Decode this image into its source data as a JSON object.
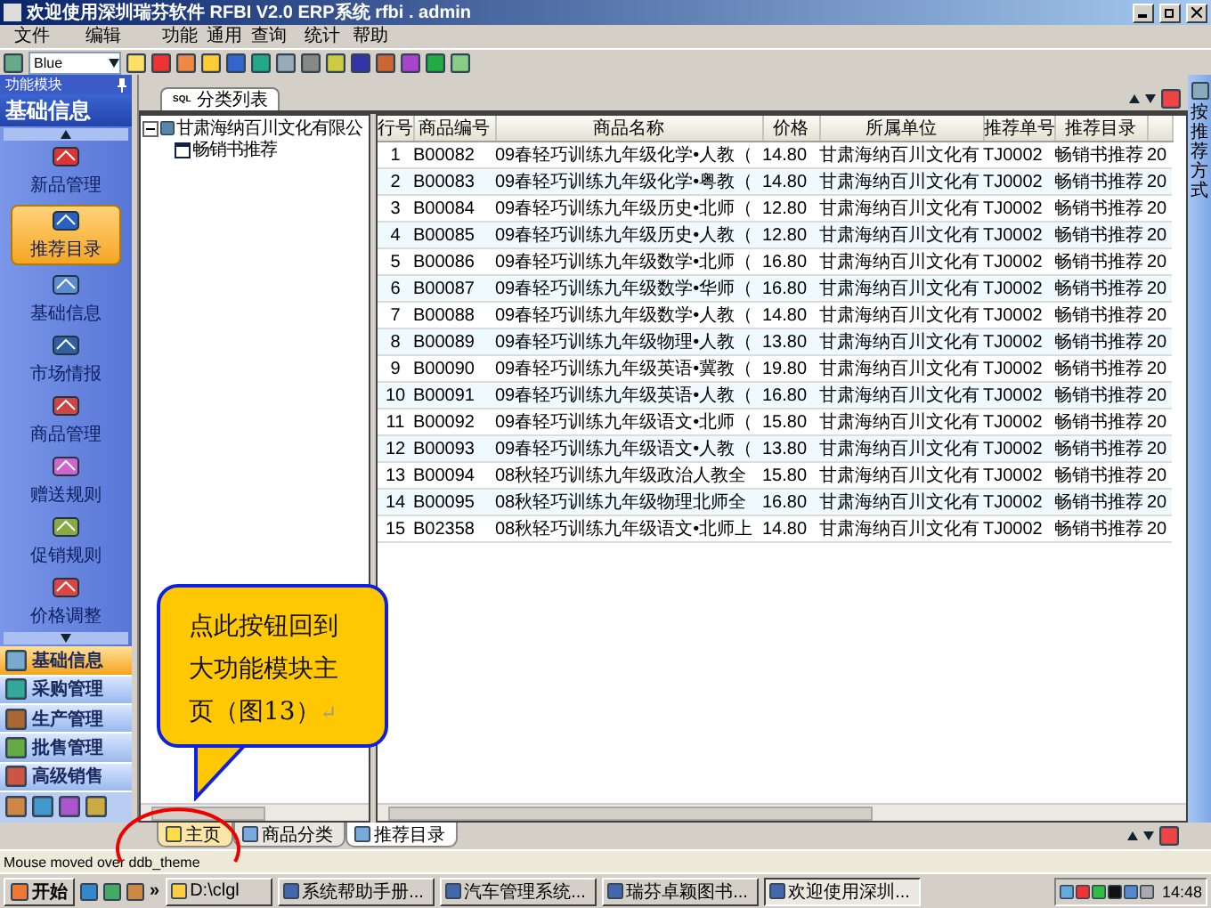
{
  "window": {
    "title": "欢迎使用深圳瑞芬软件 RFBI V2.0 ERP系统 rfbi . admin"
  },
  "menu": [
    "文件",
    "编辑",
    "功能",
    "通用",
    "查询",
    "统计",
    "帮助"
  ],
  "toolbar": {
    "theme_combo": {
      "value": "Blue"
    }
  },
  "sidebar": {
    "header": "功能模块",
    "title": "基础信息",
    "items": [
      {
        "label": "新品管理",
        "selected": false
      },
      {
        "label": "推荐目录",
        "selected": true
      },
      {
        "label": "基础信息",
        "selected": false
      },
      {
        "label": "市场情报",
        "selected": false
      },
      {
        "label": "商品管理",
        "selected": false
      },
      {
        "label": "赠送规则",
        "selected": false
      },
      {
        "label": "促销规则",
        "selected": false
      },
      {
        "label": "价格调整",
        "selected": false
      }
    ],
    "modules": [
      {
        "label": "基础信息",
        "selected": true
      },
      {
        "label": "采购管理",
        "selected": false
      },
      {
        "label": "生产管理",
        "selected": false
      },
      {
        "label": "批售管理",
        "selected": false
      },
      {
        "label": "高级销售",
        "selected": false
      }
    ]
  },
  "doc_tab": {
    "prefix": "SQL",
    "label": "分类列表"
  },
  "tree": {
    "label": "甘肃海纳百川文化有限公",
    "expanded": true,
    "children": [
      {
        "label": "畅销书推荐"
      }
    ]
  },
  "table": {
    "columns": [
      "行号",
      "商品编号",
      "商品名称",
      "价格",
      "所属单位",
      "推荐单号",
      "推荐目录"
    ],
    "rows": [
      [
        "1",
        "B00082",
        "09春轻巧训练九年级化学•人教（",
        "14.80",
        "甘肃海纳百川文化有",
        "TJ0002",
        "畅销书推荐",
        "20"
      ],
      [
        "2",
        "B00083",
        "09春轻巧训练九年级化学•粤教（",
        "14.80",
        "甘肃海纳百川文化有",
        "TJ0002",
        "畅销书推荐",
        "20"
      ],
      [
        "3",
        "B00084",
        "09春轻巧训练九年级历史•北师（",
        "12.80",
        "甘肃海纳百川文化有",
        "TJ0002",
        "畅销书推荐",
        "20"
      ],
      [
        "4",
        "B00085",
        "09春轻巧训练九年级历史•人教（",
        "12.80",
        "甘肃海纳百川文化有",
        "TJ0002",
        "畅销书推荐",
        "20"
      ],
      [
        "5",
        "B00086",
        "09春轻巧训练九年级数学•北师（",
        "16.80",
        "甘肃海纳百川文化有",
        "TJ0002",
        "畅销书推荐",
        "20"
      ],
      [
        "6",
        "B00087",
        "09春轻巧训练九年级数学•华师（",
        "16.80",
        "甘肃海纳百川文化有",
        "TJ0002",
        "畅销书推荐",
        "20"
      ],
      [
        "7",
        "B00088",
        "09春轻巧训练九年级数学•人教（",
        "14.80",
        "甘肃海纳百川文化有",
        "TJ0002",
        "畅销书推荐",
        "20"
      ],
      [
        "8",
        "B00089",
        "09春轻巧训练九年级物理•人教（",
        "13.80",
        "甘肃海纳百川文化有",
        "TJ0002",
        "畅销书推荐",
        "20"
      ],
      [
        "9",
        "B00090",
        "09春轻巧训练九年级英语•冀教（",
        "19.80",
        "甘肃海纳百川文化有",
        "TJ0002",
        "畅销书推荐",
        "20"
      ],
      [
        "10",
        "B00091",
        "09春轻巧训练九年级英语•人教（",
        "16.80",
        "甘肃海纳百川文化有",
        "TJ0002",
        "畅销书推荐",
        "20"
      ],
      [
        "11",
        "B00092",
        "09春轻巧训练九年级语文•北师（",
        "15.80",
        "甘肃海纳百川文化有",
        "TJ0002",
        "畅销书推荐",
        "20"
      ],
      [
        "12",
        "B00093",
        "09春轻巧训练九年级语文•人教（",
        "13.80",
        "甘肃海纳百川文化有",
        "TJ0002",
        "畅销书推荐",
        "20"
      ],
      [
        "13",
        "B00094",
        "08秋轻巧训练九年级政治人教全",
        "15.80",
        "甘肃海纳百川文化有",
        "TJ0002",
        "畅销书推荐",
        "20"
      ],
      [
        "14",
        "B00095",
        "08秋轻巧训练九年级物理北师全",
        "16.80",
        "甘肃海纳百川文化有",
        "TJ0002",
        "畅销书推荐",
        "20"
      ],
      [
        "15",
        "B02358",
        "08秋轻巧训练九年级语文•北师上",
        "14.80",
        "甘肃海纳百川文化有",
        "TJ0002",
        "畅销书推荐",
        "20"
      ]
    ]
  },
  "side_strip": {
    "label": "按推荐方式"
  },
  "bottom_tabs": [
    {
      "label": "主页",
      "selected": false,
      "highlighted": true
    },
    {
      "label": "商品分类",
      "selected": false,
      "highlighted": false
    },
    {
      "label": "推荐目录",
      "selected": true,
      "highlighted": false
    }
  ],
  "status_bar": "Mouse moved over ddb_theme",
  "callout": {
    "text": "点此按钮回到大功能模块主页（图13）",
    "mark": "↵"
  },
  "taskbar": {
    "start": "开始",
    "more": "»",
    "windows": [
      {
        "label": "D:\\clgl",
        "selected": false
      },
      {
        "label": "系统帮助手册...",
        "selected": false
      },
      {
        "label": "汽车管理系统...",
        "selected": false
      },
      {
        "label": "瑞芬卓颖图书...",
        "selected": false
      },
      {
        "label": "欢迎使用深圳...",
        "selected": true
      }
    ],
    "clock": "14:48"
  }
}
